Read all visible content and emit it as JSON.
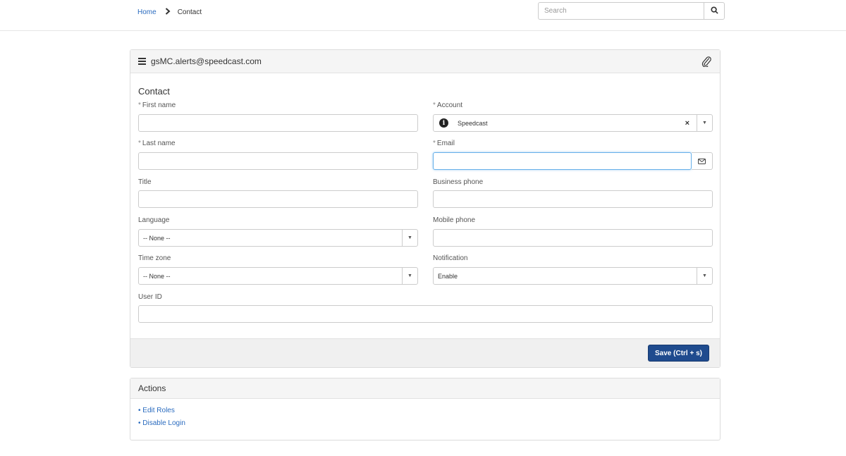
{
  "breadcrumb": {
    "home": "Home",
    "current": "Contact"
  },
  "search": {
    "placeholder": "Search"
  },
  "record": {
    "title": "gsMC.alerts@speedcast.com"
  },
  "form": {
    "heading": "Contact",
    "required_marker": "*",
    "first_name": {
      "label": "First name",
      "value": ""
    },
    "last_name": {
      "label": "Last name",
      "value": ""
    },
    "title": {
      "label": "Title",
      "value": ""
    },
    "language": {
      "label": "Language",
      "value": "-- None --"
    },
    "time_zone": {
      "label": "Time zone",
      "value": "-- None --"
    },
    "user_id": {
      "label": "User ID",
      "value": ""
    },
    "account": {
      "label": "Account",
      "value": "Speedcast"
    },
    "email": {
      "label": "Email",
      "value": ""
    },
    "business_phone": {
      "label": "Business phone",
      "value": ""
    },
    "mobile_phone": {
      "label": "Mobile phone",
      "value": ""
    },
    "notification": {
      "label": "Notification",
      "value": "Enable"
    }
  },
  "footer": {
    "save_label": "Save (Ctrl + s)"
  },
  "actions": {
    "title": "Actions",
    "links": [
      "• Edit Roles",
      "• Disable Login"
    ]
  },
  "colors": {
    "primary_button": "#1f4b8e",
    "link": "#2a6bbf",
    "focus_border": "#66afe9"
  }
}
